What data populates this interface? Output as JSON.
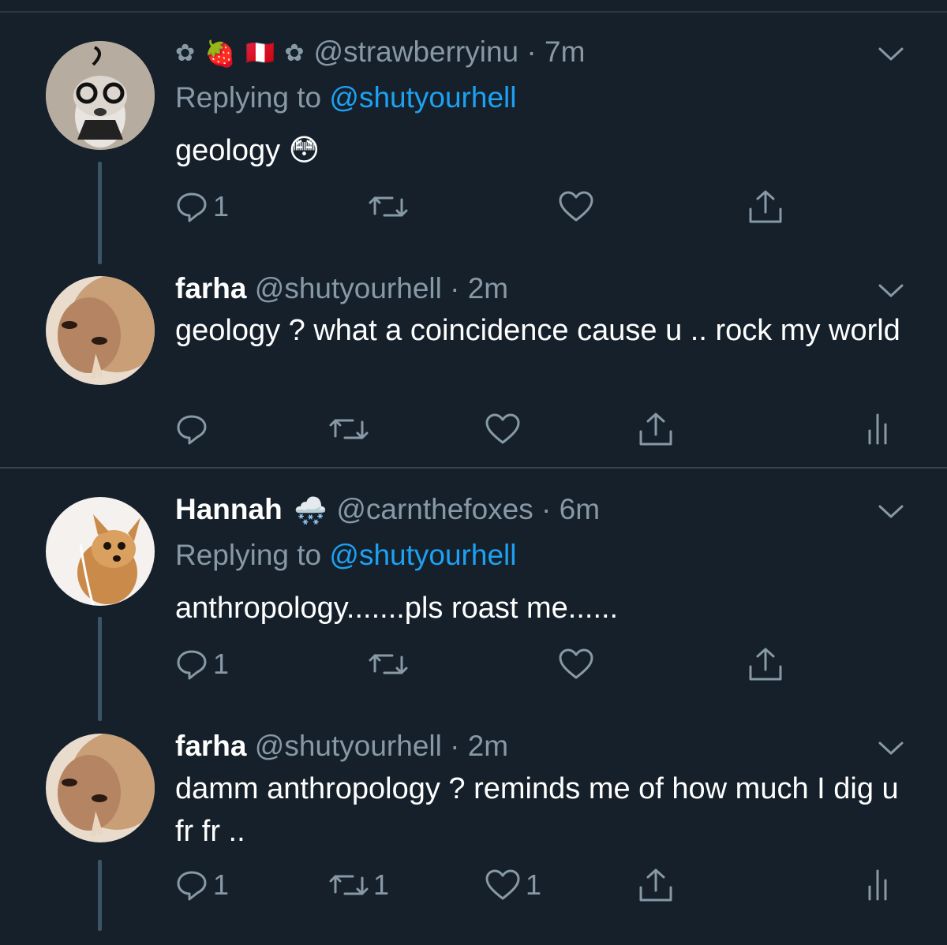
{
  "tweets": [
    {
      "name": "",
      "name_emoji": [
        "✿",
        "🍓",
        "🇵🇪",
        "✿"
      ],
      "handle": "@strawberryinu",
      "time": "7m",
      "replying_prefix": "Replying to",
      "replying_to": "@shutyourhell",
      "text": "geology 😳",
      "reply_count": "1",
      "retweet_count": "",
      "like_count": ""
    },
    {
      "name": "farha",
      "handle": "@shutyourhell",
      "time": "2m",
      "text": "geology ? what a coincidence cause u .. rock my world",
      "reply_count": "",
      "retweet_count": "",
      "like_count": ""
    },
    {
      "name": "Hannah",
      "name_emoji": "🌨️",
      "handle": "@carnthefoxes",
      "time": "6m",
      "replying_prefix": "Replying to",
      "replying_to": "@shutyourhell",
      "text": "anthropology.......pls roast me......",
      "reply_count": "1",
      "retweet_count": "",
      "like_count": ""
    },
    {
      "name": "farha",
      "handle": "@shutyourhell",
      "time": "2m",
      "text": "damm anthropology ? reminds me of how much I dig u fr fr ..",
      "reply_count": "1",
      "retweet_count": "1",
      "like_count": "1"
    }
  ],
  "separator": " · ",
  "icons": {
    "reply": "reply-icon",
    "retweet": "retweet-icon",
    "like": "heart-icon",
    "share": "share-icon",
    "analytics": "analytics-icon",
    "more": "chevron-down-icon"
  },
  "colors": {
    "background": "#15202b",
    "text": "#ffffff",
    "secondary": "#8899a6",
    "link": "#1da1f2"
  }
}
